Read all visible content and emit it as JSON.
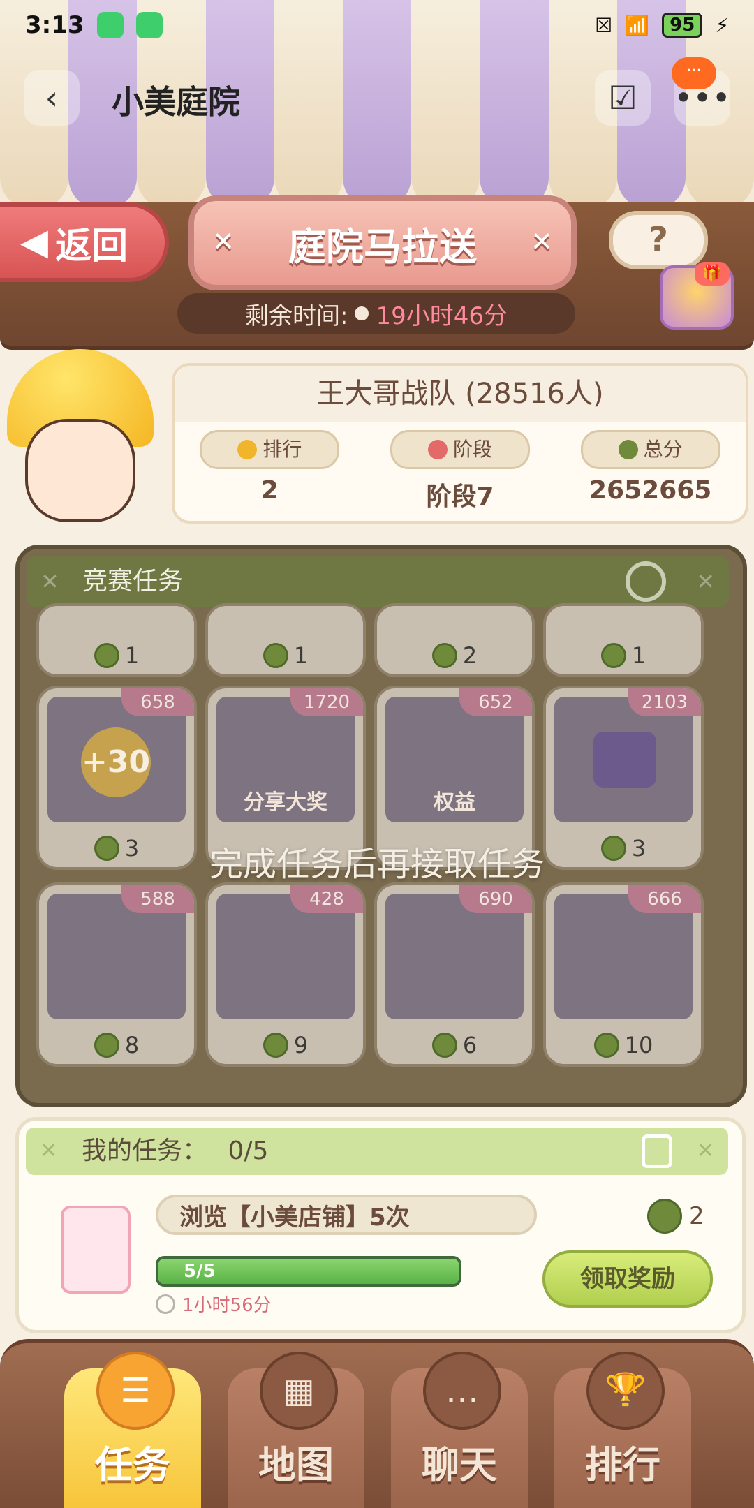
{
  "status_bar": {
    "time": "3:13",
    "battery": "95",
    "signal_icons": [
      "close-box-icon",
      "wifi-icon",
      "bolt-icon"
    ]
  },
  "nav": {
    "title": "小美庭院",
    "notif_text": "···"
  },
  "game": {
    "back_label": "返回",
    "title": "庭院马拉送",
    "help_label": "?",
    "timer_label": "剩余时间:",
    "timer_value": "19小时46分"
  },
  "team": {
    "name": "王大哥战队 (28516人)",
    "stats": [
      {
        "label": "排行",
        "value": "2",
        "icon_color": "#f0b52b"
      },
      {
        "label": "阶段",
        "value": "阶段7",
        "icon_color": "#e46a6a"
      },
      {
        "label": "总分",
        "value": "2652665",
        "icon_color": "#6e8a3a"
      }
    ]
  },
  "race": {
    "header": "竞赛任务",
    "overlay_text": "完成任务后再接取任务",
    "top_scores": [
      "1",
      "1",
      "2",
      "1"
    ],
    "tasks": [
      {
        "badge": "658",
        "score": "3",
        "img_text": "+30"
      },
      {
        "badge": "1720",
        "score": "",
        "img_text": "分享大奖"
      },
      {
        "badge": "652",
        "score": "",
        "img_text": "权益"
      },
      {
        "badge": "2103",
        "score": "3",
        "img_text": ""
      },
      {
        "badge": "588",
        "score": "8",
        "img_text": ""
      },
      {
        "badge": "428",
        "score": "9",
        "img_text": ""
      },
      {
        "badge": "690",
        "score": "6",
        "img_text": ""
      },
      {
        "badge": "666",
        "score": "10",
        "img_text": ""
      }
    ]
  },
  "my_task": {
    "header": "我的任务：",
    "count": "0/5",
    "name": "浏览【小美店铺】5次",
    "reward": "2",
    "progress_label": "5/5",
    "progress_fraction": 1.0,
    "time_left": "1小时56分",
    "claim_label": "领取奖励"
  },
  "tabs": [
    {
      "label": "任务",
      "icon": "list-icon",
      "active": true
    },
    {
      "label": "地图",
      "icon": "map-icon",
      "active": false
    },
    {
      "label": "聊天",
      "icon": "chat-icon",
      "active": false
    },
    {
      "label": "排行",
      "icon": "trophy-icon",
      "active": false
    }
  ]
}
